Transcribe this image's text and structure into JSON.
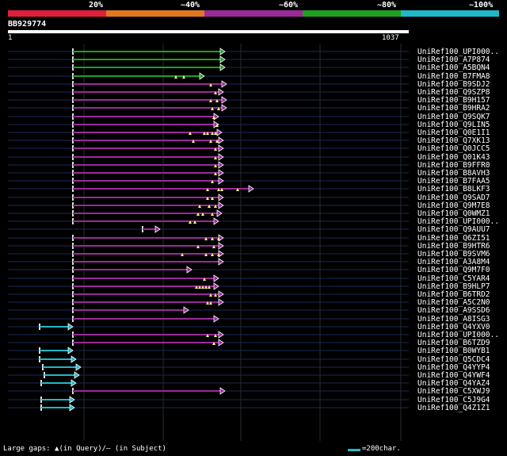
{
  "scale_bands": [
    {
      "label": "20%",
      "color": "#e0203a"
    },
    {
      "label": "~40%",
      "color": "#e07820"
    },
    {
      "label": "~60%",
      "color": "#9a2a9a"
    },
    {
      "label": "~80%",
      "color": "#20a020"
    },
    {
      "label": "~100%",
      "color": "#20b8c8"
    }
  ],
  "query": {
    "name": "BB929774",
    "start": "1",
    "end": "1037"
  },
  "hits": [
    {
      "id": "UniRef100_UPI000..",
      "color": "#20a020"
    },
    {
      "id": "UniRef100_A7P874",
      "color": "#20a020"
    },
    {
      "id": "UniRef100_A5BQN4",
      "color": "#20a020"
    },
    {
      "id": "UniRef100_B7FMA8",
      "color": "#20a020"
    },
    {
      "id": "UniRef100_B9SDJ2",
      "color": "#9a2a9a"
    },
    {
      "id": "UniRef100_Q9SZP8",
      "color": "#9a2a9a"
    },
    {
      "id": "UniRef100_B9H157",
      "color": "#9a2a9a"
    },
    {
      "id": "UniRef100_B9HRA2",
      "color": "#9a2a9a"
    },
    {
      "id": "UniRef100_Q9SQK7",
      "color": "#9a2a9a"
    },
    {
      "id": "UniRef100_Q9LIN5",
      "color": "#9a2a9a"
    },
    {
      "id": "UniRef100_Q0E1I1",
      "color": "#9a2a9a"
    },
    {
      "id": "UniRef100_Q7XK13",
      "color": "#9a2a9a"
    },
    {
      "id": "UniRef100_Q0JCC5",
      "color": "#9a2a9a"
    },
    {
      "id": "UniRef100_Q01K43",
      "color": "#9a2a9a"
    },
    {
      "id": "UniRef100_B9FFR0",
      "color": "#9a2a9a"
    },
    {
      "id": "UniRef100_B8AVH3",
      "color": "#9a2a9a"
    },
    {
      "id": "UniRef100_B7FAA5",
      "color": "#9a2a9a"
    },
    {
      "id": "UniRef100_B8LKF3",
      "color": "#9a2a9a"
    },
    {
      "id": "UniRef100_Q9SAD7",
      "color": "#9a2a9a"
    },
    {
      "id": "UniRef100_Q9M7E8",
      "color": "#9a2a9a"
    },
    {
      "id": "UniRef100_Q0WMZ1",
      "color": "#9a2a9a"
    },
    {
      "id": "UniRef100_UPI000..",
      "color": "#9a2a9a"
    },
    {
      "id": "UniRef100_Q9AUU7",
      "color": "#9a2a9a"
    },
    {
      "id": "UniRef100_Q6ZI51",
      "color": "#9a2a9a"
    },
    {
      "id": "UniRef100_B9HTR6",
      "color": "#9a2a9a"
    },
    {
      "id": "UniRef100_B9SVM6",
      "color": "#9a2a9a"
    },
    {
      "id": "UniRef100_A3A8M4",
      "color": "#9a2a9a"
    },
    {
      "id": "UniRef100_Q9M7F0",
      "color": "#9a2a9a"
    },
    {
      "id": "UniRef100_C5YAR4",
      "color": "#9a2a9a"
    },
    {
      "id": "UniRef100_B9HLP7",
      "color": "#9a2a9a"
    },
    {
      "id": "UniRef100_B6TRD2",
      "color": "#9a2a9a"
    },
    {
      "id": "UniRef100_A5C2N0",
      "color": "#9a2a9a"
    },
    {
      "id": "UniRef100_A9SSD6",
      "color": "#9a2a9a"
    },
    {
      "id": "UniRef100_A8ISG3",
      "color": "#9a2a9a"
    },
    {
      "id": "UniRef100_Q4YXV0",
      "color": "#20b8c8"
    },
    {
      "id": "UniRef100_UPI000..",
      "color": "#9a2a9a"
    },
    {
      "id": "UniRef100_B6TZD9",
      "color": "#9a2a9a"
    },
    {
      "id": "UniRef100_B0WYB1",
      "color": "#20b8c8"
    },
    {
      "id": "UniRef100_Q5CDC4",
      "color": "#20b8c8"
    },
    {
      "id": "UniRef100_Q4YYP4",
      "color": "#20b8c8"
    },
    {
      "id": "UniRef100_Q4YWF4",
      "color": "#20b8c8"
    },
    {
      "id": "UniRef100_Q4YAZ4",
      "color": "#20b8c8"
    },
    {
      "id": "UniRef100_C5XWJ9",
      "color": "#9a2a9a"
    },
    {
      "id": "UniRef100_C5J9G4",
      "color": "#20b8c8"
    },
    {
      "id": "UniRef100_Q4Z1Z1",
      "color": "#20b8c8"
    }
  ],
  "legend": {
    "gaps_text": "Large gaps: ▲(in Query)/– (in Subject)",
    "scale_text": "=200char."
  }
}
